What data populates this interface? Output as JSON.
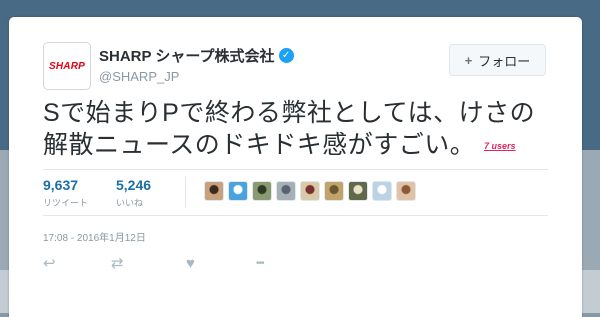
{
  "account": {
    "display_name": "SHARP シャープ株式会社",
    "handle": "@SHARP_JP",
    "logo_text": "SHARP",
    "verified_glyph": "✓"
  },
  "follow_button": {
    "label": "フォロー",
    "icon": "follow-user-icon",
    "icon_glyph": "+"
  },
  "tweet": {
    "line1": "Sで始まりPで終わる弊社としては、けさの",
    "line2": "解散ニュースのドキドキ感がすごい。",
    "users_annotation": "7 users"
  },
  "stats": {
    "retweets": {
      "count": "9,637",
      "label": "リツイート"
    },
    "likes": {
      "count": "5,246",
      "label": "いいね"
    }
  },
  "liker_avatars": [
    {
      "color": "#c8a27e",
      "accent": "#3a2a20"
    },
    {
      "color": "#4aa3df",
      "accent": "#ffffff"
    },
    {
      "color": "#8c9a72",
      "accent": "#2f3a24"
    },
    {
      "color": "#a7b0b7",
      "accent": "#5a6470"
    },
    {
      "color": "#d9c9a9",
      "accent": "#7a3030"
    },
    {
      "color": "#c2a36a",
      "accent": "#6b5632"
    },
    {
      "color": "#606a4a",
      "accent": "#e8e2c8"
    },
    {
      "color": "#bcd3e6",
      "accent": "#ffffff"
    },
    {
      "color": "#e0c2a6",
      "accent": "#8a5a3a"
    }
  ],
  "timestamp": "17:08 - 2016年1月12日",
  "actions": [
    {
      "name": "reply-icon",
      "glyph": "↩"
    },
    {
      "name": "retweet-icon",
      "glyph": "⇄"
    },
    {
      "name": "like-icon",
      "glyph": "♥"
    },
    {
      "name": "more-icon",
      "glyph": "•••"
    }
  ],
  "colors": {
    "link_blue": "#1b6fa6",
    "verified_blue": "#1da1f2",
    "brand_red": "#e60012",
    "annotation_red": "#e0245e"
  }
}
